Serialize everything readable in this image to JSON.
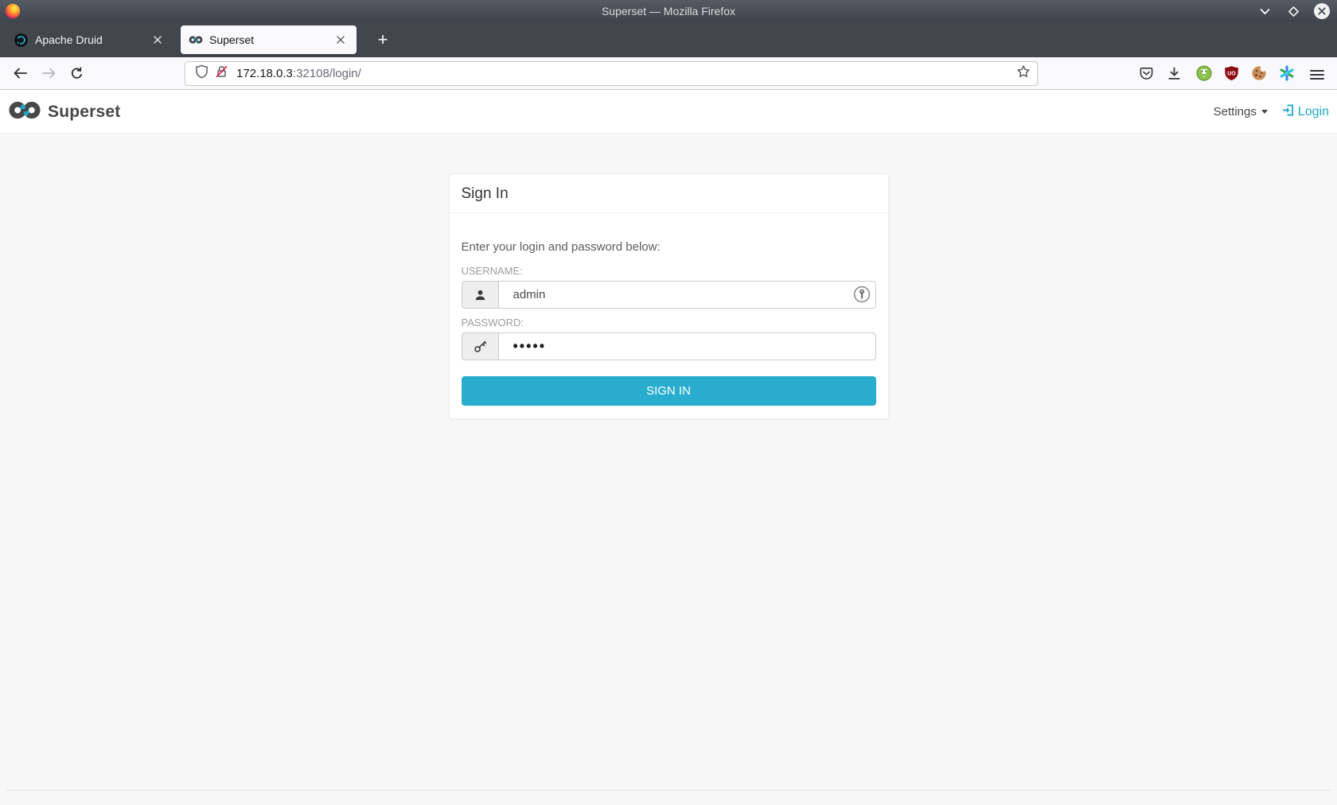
{
  "window": {
    "title": "Superset — Mozilla Firefox"
  },
  "browser": {
    "tabs": [
      {
        "label": "Apache Druid",
        "active": false
      },
      {
        "label": "Superset",
        "active": true
      }
    ],
    "new_tab_label": "+",
    "url": {
      "host": "172.18.0.3",
      "path": ":32108/login/"
    }
  },
  "app": {
    "brand": "Superset",
    "nav": {
      "settings": "Settings",
      "login": "Login"
    }
  },
  "login_form": {
    "title": "Sign In",
    "instruction": "Enter your login and password below:",
    "username": {
      "label": "USERNAME:",
      "value": "admin"
    },
    "password": {
      "label": "PASSWORD:",
      "value": "•••••"
    },
    "submit": "SIGN IN"
  },
  "colors": {
    "accent": "#20A7C9",
    "signin_button": "#29ADCF",
    "titlebar": "#474d55",
    "tabbar": "#42474e",
    "insecure_slash": "#e0264e",
    "page_background": "#f7f7f7"
  },
  "icons": {
    "firefox-logo-icon": "firefox flame",
    "minimize-icon": "chevron-down",
    "maximize-icon": "diamond outline",
    "close-icon": "circle with x",
    "druid-favicon-icon": "dark circle cyan swirl",
    "superset-favicon-icon": "infinity",
    "tab-close-icon": "x",
    "back-icon": "arrow-left",
    "forward-icon": "arrow-right",
    "reload-icon": "refresh arc",
    "shield-icon": "tracking protection shield",
    "lock-slash-icon": "lock with red slash",
    "bookmark-star-icon": "star outline",
    "pocket-icon": "pocket pouch chevron",
    "download-icon": "arrow into tray",
    "privacy-badger-icon": "green circle badger",
    "ublock-origin-icon": "dark red shield",
    "ublock-badge-text": "UO",
    "cookie-icon": "bitten cookie",
    "extension-asterisk-icon": "colorful asterisk",
    "menu-icon": "hamburger lines",
    "superset-logo-icon": "infinity with cyan accents",
    "caret-down-icon": "small down triangle",
    "login-icon": "arrow into bracket",
    "user-icon": "person silhouette",
    "key-icon": "key outline",
    "keepassxc-icon": "gray circle key"
  }
}
